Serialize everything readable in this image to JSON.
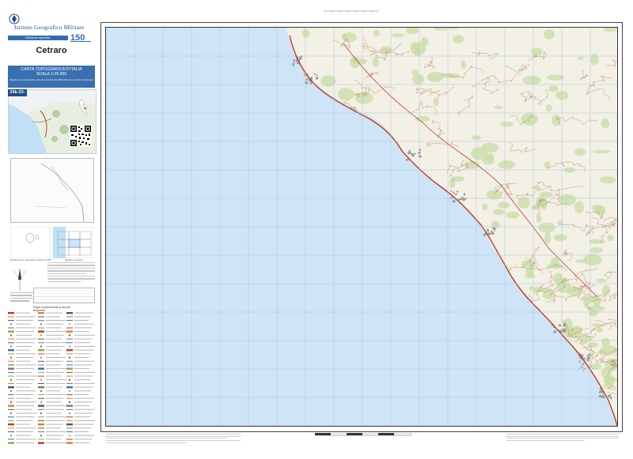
{
  "header": {
    "institute": "Istituto Geografico Militare",
    "edition_label": "Edizione speciale",
    "anniversary": "150"
  },
  "sheet": {
    "name": "Cetraro",
    "series_title": "CARTA TOPOGRAFICA D'ITALIA",
    "scale": "SCALA 1:25 000",
    "series_note": "Allestimento cartografico derivato dai dati del DBN Edizione di Antico Nazionale",
    "code": "25k-33-43"
  },
  "map": {
    "sea_color": "#cde5f7",
    "land_color": "#f3f0e6",
    "forest_color": "#c7dea3",
    "contour_color": "#b5805a",
    "road_color": "#c0392b",
    "grid_color": "#a9c7dc",
    "urban_color": "#9a9a9a"
  },
  "captions": {
    "declination": "Declinazione magnetica: Ovest di 3.50°",
    "index": "Quadro di unione",
    "legend_title": "Segni convenzionali di uso più frequente"
  }
}
